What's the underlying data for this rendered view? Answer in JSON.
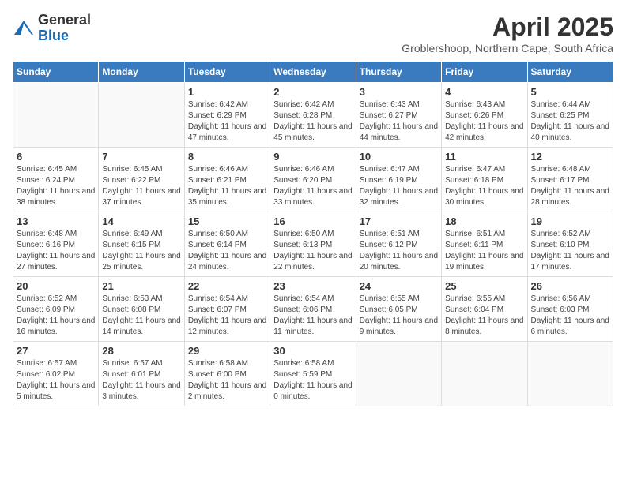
{
  "header": {
    "logo_general": "General",
    "logo_blue": "Blue",
    "month_title": "April 2025",
    "location": "Groblershoop, Northern Cape, South Africa"
  },
  "days_of_week": [
    "Sunday",
    "Monday",
    "Tuesday",
    "Wednesday",
    "Thursday",
    "Friday",
    "Saturday"
  ],
  "weeks": [
    [
      {
        "day": "",
        "info": ""
      },
      {
        "day": "",
        "info": ""
      },
      {
        "day": "1",
        "info": "Sunrise: 6:42 AM\nSunset: 6:29 PM\nDaylight: 11 hours and 47 minutes."
      },
      {
        "day": "2",
        "info": "Sunrise: 6:42 AM\nSunset: 6:28 PM\nDaylight: 11 hours and 45 minutes."
      },
      {
        "day": "3",
        "info": "Sunrise: 6:43 AM\nSunset: 6:27 PM\nDaylight: 11 hours and 44 minutes."
      },
      {
        "day": "4",
        "info": "Sunrise: 6:43 AM\nSunset: 6:26 PM\nDaylight: 11 hours and 42 minutes."
      },
      {
        "day": "5",
        "info": "Sunrise: 6:44 AM\nSunset: 6:25 PM\nDaylight: 11 hours and 40 minutes."
      }
    ],
    [
      {
        "day": "6",
        "info": "Sunrise: 6:45 AM\nSunset: 6:24 PM\nDaylight: 11 hours and 38 minutes."
      },
      {
        "day": "7",
        "info": "Sunrise: 6:45 AM\nSunset: 6:22 PM\nDaylight: 11 hours and 37 minutes."
      },
      {
        "day": "8",
        "info": "Sunrise: 6:46 AM\nSunset: 6:21 PM\nDaylight: 11 hours and 35 minutes."
      },
      {
        "day": "9",
        "info": "Sunrise: 6:46 AM\nSunset: 6:20 PM\nDaylight: 11 hours and 33 minutes."
      },
      {
        "day": "10",
        "info": "Sunrise: 6:47 AM\nSunset: 6:19 PM\nDaylight: 11 hours and 32 minutes."
      },
      {
        "day": "11",
        "info": "Sunrise: 6:47 AM\nSunset: 6:18 PM\nDaylight: 11 hours and 30 minutes."
      },
      {
        "day": "12",
        "info": "Sunrise: 6:48 AM\nSunset: 6:17 PM\nDaylight: 11 hours and 28 minutes."
      }
    ],
    [
      {
        "day": "13",
        "info": "Sunrise: 6:48 AM\nSunset: 6:16 PM\nDaylight: 11 hours and 27 minutes."
      },
      {
        "day": "14",
        "info": "Sunrise: 6:49 AM\nSunset: 6:15 PM\nDaylight: 11 hours and 25 minutes."
      },
      {
        "day": "15",
        "info": "Sunrise: 6:50 AM\nSunset: 6:14 PM\nDaylight: 11 hours and 24 minutes."
      },
      {
        "day": "16",
        "info": "Sunrise: 6:50 AM\nSunset: 6:13 PM\nDaylight: 11 hours and 22 minutes."
      },
      {
        "day": "17",
        "info": "Sunrise: 6:51 AM\nSunset: 6:12 PM\nDaylight: 11 hours and 20 minutes."
      },
      {
        "day": "18",
        "info": "Sunrise: 6:51 AM\nSunset: 6:11 PM\nDaylight: 11 hours and 19 minutes."
      },
      {
        "day": "19",
        "info": "Sunrise: 6:52 AM\nSunset: 6:10 PM\nDaylight: 11 hours and 17 minutes."
      }
    ],
    [
      {
        "day": "20",
        "info": "Sunrise: 6:52 AM\nSunset: 6:09 PM\nDaylight: 11 hours and 16 minutes."
      },
      {
        "day": "21",
        "info": "Sunrise: 6:53 AM\nSunset: 6:08 PM\nDaylight: 11 hours and 14 minutes."
      },
      {
        "day": "22",
        "info": "Sunrise: 6:54 AM\nSunset: 6:07 PM\nDaylight: 11 hours and 12 minutes."
      },
      {
        "day": "23",
        "info": "Sunrise: 6:54 AM\nSunset: 6:06 PM\nDaylight: 11 hours and 11 minutes."
      },
      {
        "day": "24",
        "info": "Sunrise: 6:55 AM\nSunset: 6:05 PM\nDaylight: 11 hours and 9 minutes."
      },
      {
        "day": "25",
        "info": "Sunrise: 6:55 AM\nSunset: 6:04 PM\nDaylight: 11 hours and 8 minutes."
      },
      {
        "day": "26",
        "info": "Sunrise: 6:56 AM\nSunset: 6:03 PM\nDaylight: 11 hours and 6 minutes."
      }
    ],
    [
      {
        "day": "27",
        "info": "Sunrise: 6:57 AM\nSunset: 6:02 PM\nDaylight: 11 hours and 5 minutes."
      },
      {
        "day": "28",
        "info": "Sunrise: 6:57 AM\nSunset: 6:01 PM\nDaylight: 11 hours and 3 minutes."
      },
      {
        "day": "29",
        "info": "Sunrise: 6:58 AM\nSunset: 6:00 PM\nDaylight: 11 hours and 2 minutes."
      },
      {
        "day": "30",
        "info": "Sunrise: 6:58 AM\nSunset: 5:59 PM\nDaylight: 11 hours and 0 minutes."
      },
      {
        "day": "",
        "info": ""
      },
      {
        "day": "",
        "info": ""
      },
      {
        "day": "",
        "info": ""
      }
    ]
  ]
}
